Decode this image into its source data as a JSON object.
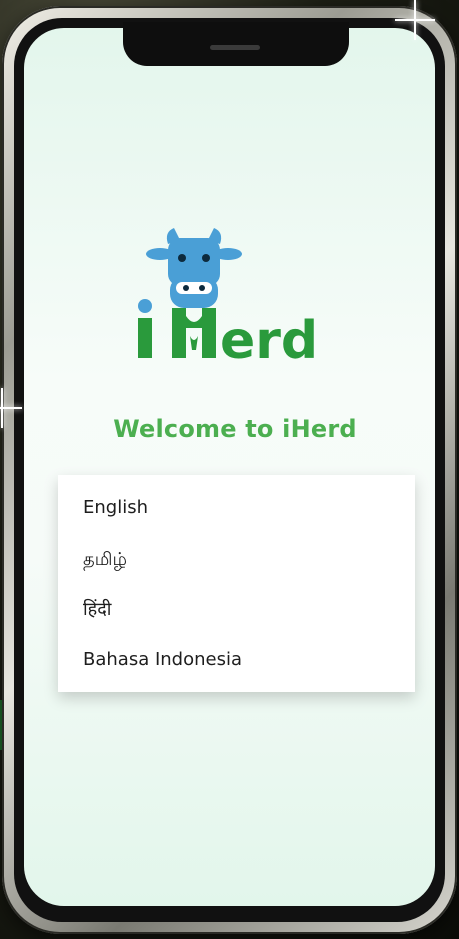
{
  "welcome": "Welcome to iHerd",
  "logo": {
    "wordmark_prefix": "i",
    "wordmark_suffix": "erd",
    "name": "iHerd",
    "colors": {
      "cow": "#4a9fd6",
      "text": "#2a9a3c"
    }
  },
  "languages": [
    {
      "label": "English"
    },
    {
      "label": "தமிழ்"
    },
    {
      "label": "हिंदी"
    },
    {
      "label": "Bahasa Indonesia"
    }
  ],
  "colors": {
    "welcome_text": "#4caf50",
    "screen_bg": "#e3f6ec"
  }
}
